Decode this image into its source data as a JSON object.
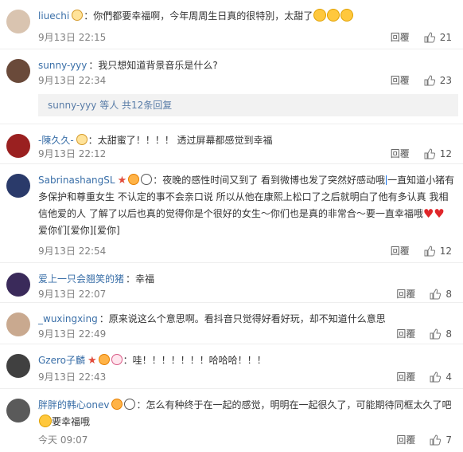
{
  "actions": {
    "reply_label": "回覆"
  },
  "sub_reply": {
    "text": "sunny-yyy 等人 共12条回复"
  },
  "comments": [
    {
      "user": "liuechi",
      "text": "你們都要幸福啊，今年周周生日真的很特別，太甜了",
      "time": "9月13日 22:15",
      "likes": "21",
      "avatar_color": "#d9c4b0"
    },
    {
      "user": "sunny-yyy",
      "text": "我只想知道背景音乐是什么?",
      "time": "9月13日 22:34",
      "likes": "23",
      "avatar_color": "#6a4a3a"
    },
    {
      "user": "-陳久久-",
      "text": "太甜蜜了！！！！ 透过屏幕都感觉到幸福",
      "time": "9月13日 22:12",
      "likes": "12",
      "avatar_color": "#9a2020"
    },
    {
      "user": "SabrinashangSL",
      "text_a": "夜晚的感性时间又到了 看到微博也发了突然好感动哦",
      "text_b": "一直知道小猪有多保护和尊重女生 不认定的事不会亲口说 所以从他在康熙上松口了之后就明白了他有多认真 我相信他爱的人 了解了以后也真的觉得你是个很好的女生～你们也是真的非常合～要一直幸福哦",
      "text_c": "爱你们[爱你][爱你]",
      "time": "9月13日 22:54",
      "likes": "12",
      "avatar_color": "#2a3a6a"
    },
    {
      "user": "爱上一只会翘笑的猪",
      "text": "幸福",
      "time": "9月13日 22:07",
      "likes": "8",
      "avatar_color": "#3a2a5a"
    },
    {
      "user": "_wuxingxing",
      "text": "原来说这么个意思啊。看抖音只觉得好看好玩，却不知道什么意思",
      "time": "9月13日 22:49",
      "likes": "8",
      "avatar_color": "#c9a98f"
    },
    {
      "user": "Gzero子麟",
      "text": "哇！！！！！！！哈哈哈！！！",
      "time": "9月13日 22:43",
      "likes": "4",
      "avatar_color": "#404040"
    },
    {
      "user": "胖胖的韩心onev",
      "text": "怎么有种终于在一起的感觉，明明在一起很久了，可能期待同框太久了吧",
      "text_b": "要幸福哦",
      "time": "今天 09:07",
      "likes": "7",
      "avatar_color": "#5a5a5a"
    }
  ]
}
